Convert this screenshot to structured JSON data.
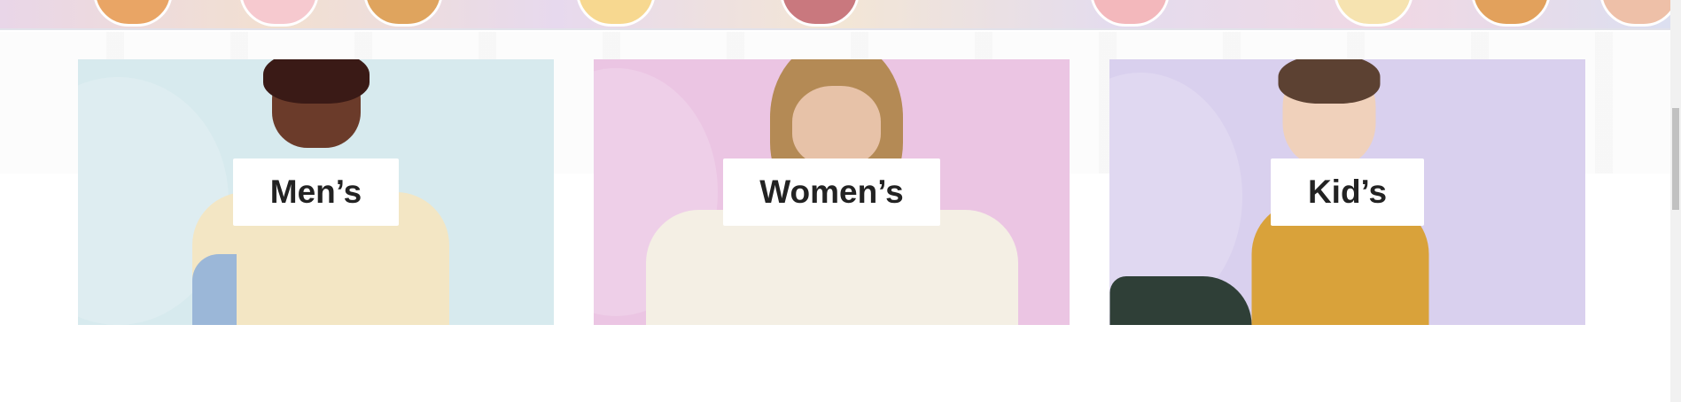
{
  "categories": [
    {
      "label": "Men’s",
      "bg": "#d7eaee"
    },
    {
      "label": "Women’s",
      "bg": "#ebc5e3"
    },
    {
      "label": "Kid’s",
      "bg": "#d9d0ee"
    }
  ]
}
